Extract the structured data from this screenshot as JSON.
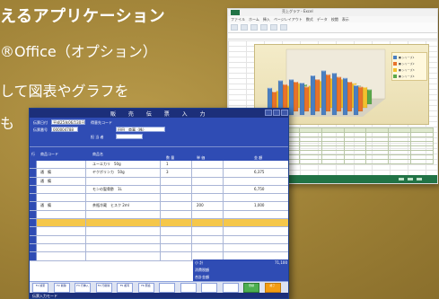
{
  "promo": {
    "heading": "えるアプリケーション",
    "line1": "®Office（オプション）",
    "line2": "して図表やグラフを",
    "line3": "も"
  },
  "spreadsheet": {
    "title": "売上グラフ - Excel",
    "tabs": [
      "ファイル",
      "ホーム",
      "挿入",
      "ページレイアウト",
      "数式",
      "データ",
      "校閲",
      "表示"
    ],
    "legend": [
      "■ シリーズ1",
      "■ シリーズ2",
      "■ シリーズ3",
      "■ シリーズ4"
    ],
    "legend_colors": [
      "#4a7fc1",
      "#e8732a",
      "#f2c12e",
      "#5aa84a"
    ],
    "table_headers": [
      "",
      "",
      "",
      "",
      "",
      "",
      "",
      ""
    ],
    "chart_data": {
      "type": "bar",
      "categories": [
        "",
        "",
        "",
        "",
        "",
        "",
        "",
        "",
        ""
      ],
      "series": [
        {
          "values": [
            55,
            70,
            72,
            65,
            80,
            90,
            85,
            75,
            60
          ]
        },
        {
          "values": [
            40,
            55,
            60,
            50,
            65,
            75,
            70,
            60,
            50
          ]
        },
        {
          "values": [
            35,
            45,
            50,
            45,
            55,
            60,
            58,
            50,
            42
          ]
        },
        {
          "values": [
            25,
            35,
            40,
            30,
            45,
            50,
            45,
            38,
            30
          ]
        }
      ]
    }
  },
  "sales_app": {
    "title": "販 売 伝 票 入 力",
    "header": {
      "slip_date_label": "伝票日付",
      "slip_date": "平成25年06月30日",
      "slip_no_label": "伝票番号",
      "slip_no": "000004788",
      "customer_code_label": "得意先コード",
      "customer_name": "田田　商事（株）",
      "staff_label": "担 当 者"
    },
    "grid_headers": [
      "行",
      "商品コード",
      "商品名",
      "数 量",
      "単 価",
      "金 額"
    ],
    "rows": [
      {
        "code": "",
        "name": "ユーエカリ　50g",
        "qty": "1",
        "price": "",
        "amount": ""
      },
      {
        "code": "通　備",
        "name": "ヤクボリンカ　50g",
        "qty": "3",
        "price": "",
        "amount": "6,375"
      },
      {
        "code": "通　備",
        "name": "",
        "qty": "",
        "price": "",
        "amount": ""
      },
      {
        "code": "",
        "name": "モンの聖骨酢　1L",
        "qty": "",
        "price": "",
        "amount": "6,750"
      },
      {
        "code": "",
        "name": "",
        "qty": "",
        "price": "",
        "amount": ""
      },
      {
        "code": "通　備",
        "name": "茶瓶冷蔵　ヒスク 2ml",
        "qty": "",
        "price": "200",
        "amount": "1,000"
      },
      {
        "code": "",
        "name": "",
        "qty": "",
        "price": "",
        "amount": ""
      },
      {
        "code": "",
        "name": "",
        "qty": "",
        "price": "",
        "amount": ""
      },
      {
        "code": "",
        "name": "",
        "qty": "",
        "price": "",
        "amount": ""
      },
      {
        "code": "",
        "name": "",
        "qty": "",
        "price": "",
        "amount": ""
      },
      {
        "code": "",
        "name": "",
        "qty": "",
        "price": "",
        "amount": ""
      },
      {
        "code": "",
        "name": "",
        "qty": "",
        "price": "",
        "amount": ""
      }
    ],
    "totals": {
      "subtotal_label": "小 計",
      "subtotal": "71,100",
      "tax_label": "消費税額",
      "tax": "",
      "total_label": "合計金額",
      "total": ""
    },
    "fkeys": [
      "F1 検索",
      "F2 削除",
      "F3 行挿入",
      "F4 行削除",
      "F5 複写",
      "F6 照会",
      "",
      "",
      "",
      "",
      "登録",
      "終了"
    ],
    "status_text": "伝票入力モード"
  }
}
